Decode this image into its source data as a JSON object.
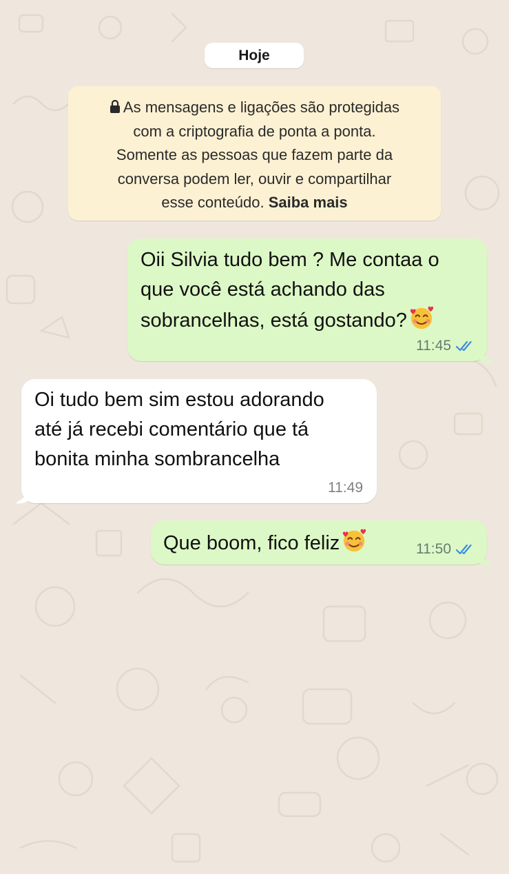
{
  "chat": {
    "date_label": "Hoje",
    "encryption_notice": {
      "line1": "As mensagens e ligações são protegidas",
      "line2": "com a criptografia de ponta a ponta.",
      "line3": "Somente as pessoas que fazem parte da",
      "line4": "conversa podem ler, ouvir e compartilhar",
      "line5_prefix": "esse conteúdo.",
      "link": "Saiba mais",
      "icon": "lock-icon"
    },
    "messages": [
      {
        "direction": "outgoing",
        "line1": "Oii Silvia tudo bem ? Me contaa o",
        "line2": "que você está achando das",
        "line3": "sobrancelhas, está gostando?",
        "emoji": "smiling-face-with-hearts",
        "time": "11:45",
        "status": "read"
      },
      {
        "direction": "incoming",
        "line1": "Oi tudo bem sim estou adorando",
        "line2": "até já recebi comentário que tá",
        "line3": "bonita minha sombrancelha",
        "time": "11:49"
      },
      {
        "direction": "outgoing",
        "line1": "Que boom, fico feliz",
        "emoji": "smiling-face-with-hearts",
        "time": "11:50",
        "status": "read"
      }
    ]
  },
  "colors": {
    "wallpaper": "#efe7dd",
    "outgoing_bubble": "#dcf8c6",
    "incoming_bubble": "#ffffff",
    "notice_bubble": "#fdf1d3",
    "read_ticks": "#3b8de0"
  }
}
